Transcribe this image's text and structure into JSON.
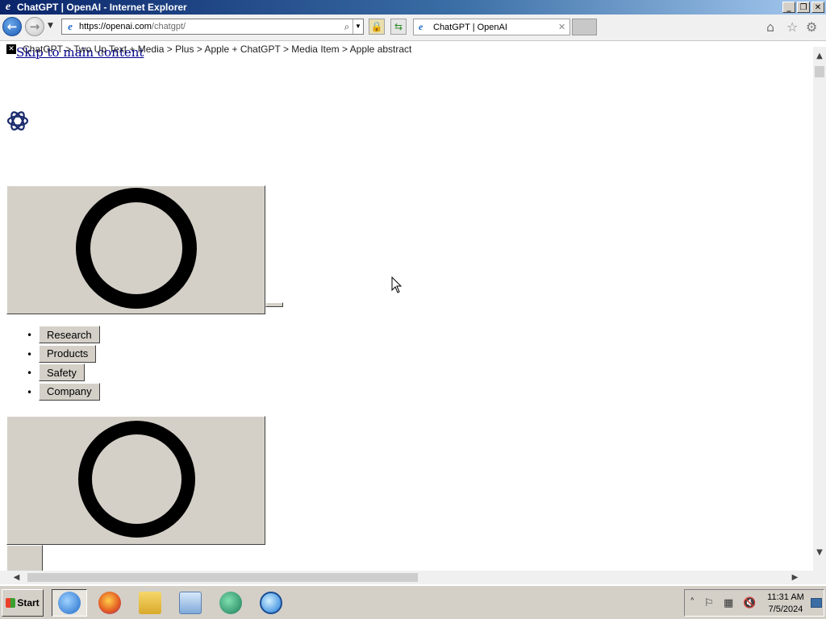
{
  "window": {
    "title": "ChatGPT | OpenAI - Internet Explorer",
    "buttons": {
      "minimize": "_",
      "restore": "❐",
      "close": "✕"
    }
  },
  "toolbar": {
    "url_host": "https://openai.com",
    "url_path": "/chatgpt/",
    "tab_title": "ChatGPT | OpenAI"
  },
  "page": {
    "skip_link": "Skip to main content",
    "breadcrumb": "ChatGPT > Two Up Text + Media > Plus > Apple + ChatGPT > Media Item > Apple abstract",
    "nav": [
      {
        "label": "Research"
      },
      {
        "label": "Products"
      },
      {
        "label": "Safety"
      },
      {
        "label": "Company"
      }
    ]
  },
  "taskbar": {
    "start_label": "Start",
    "apps": [
      "internet-explorer",
      "firefox",
      "file-explorer",
      "media-player",
      "chat-app",
      "globe-app"
    ],
    "clock_time": "11:31 AM",
    "clock_date": "7/5/2024"
  },
  "icons": {
    "back": "back-arrow-icon",
    "forward": "forward-arrow-icon",
    "home": "home-icon",
    "favorites": "star-icon",
    "settings": "gear-icon"
  },
  "colors": {
    "titlebar_start": "#0a246a",
    "titlebar_end": "#a6caf0",
    "button_face": "#d4d0c8",
    "link": "#00008b"
  }
}
